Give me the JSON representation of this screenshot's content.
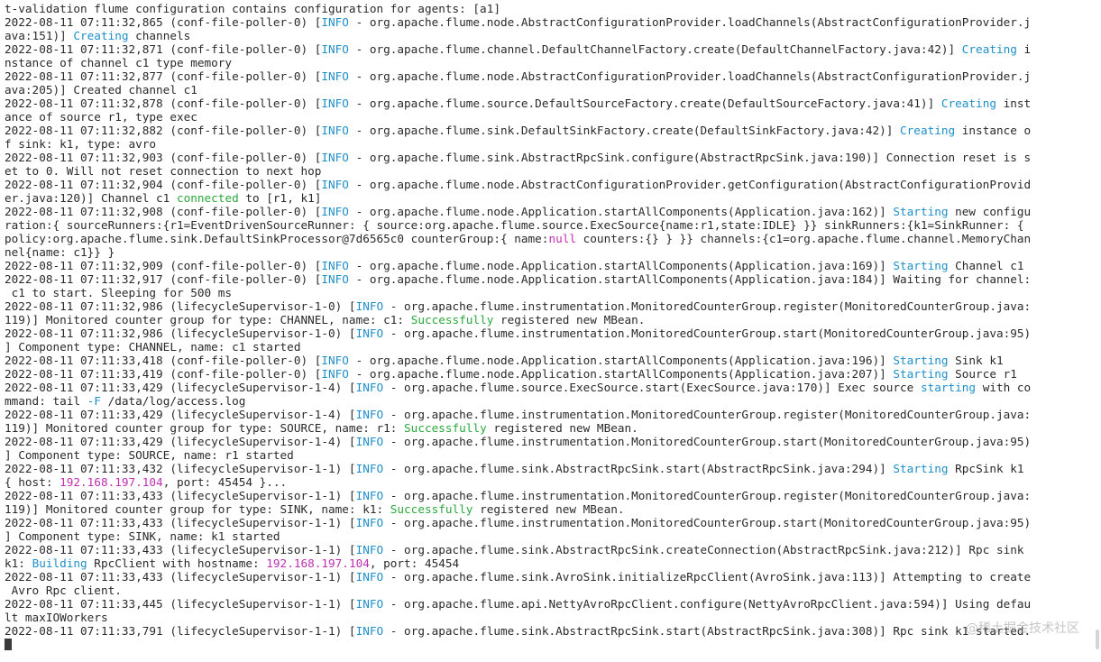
{
  "terminal": {
    "colors": {
      "background": "#ffffff",
      "text": "#2a2a2a",
      "info": "#1f8fc9",
      "keyword": "#1f8fc9",
      "success": "#2aa83d",
      "ip": "#c02fb3"
    },
    "lines": [
      [
        [
          "t-validation flume configuration contains configuration for agents: [a1]",
          ""
        ]
      ],
      [
        [
          "2022-08-11 07:11:32,865 (conf-file-poller-0) [",
          ""
        ],
        [
          "INFO",
          "info"
        ],
        [
          " - org.apache.flume.node.AbstractConfigurationProvider.loadChannels(AbstractConfigurationProvider.j",
          ""
        ]
      ],
      [
        [
          "ava:151)] ",
          ""
        ],
        [
          "Creating",
          "kw"
        ],
        [
          " channels",
          ""
        ]
      ],
      [
        [
          "2022-08-11 07:11:32,871 (conf-file-poller-0) [",
          ""
        ],
        [
          "INFO",
          "info"
        ],
        [
          " - org.apache.flume.channel.DefaultChannelFactory.create(DefaultChannelFactory.java:42)] ",
          ""
        ],
        [
          "Creating",
          "kw"
        ],
        [
          " i",
          ""
        ]
      ],
      [
        [
          "nstance of channel c1 type memory",
          ""
        ]
      ],
      [
        [
          "2022-08-11 07:11:32,877 (conf-file-poller-0) [",
          ""
        ],
        [
          "INFO",
          "info"
        ],
        [
          " - org.apache.flume.node.AbstractConfigurationProvider.loadChannels(AbstractConfigurationProvider.j",
          ""
        ]
      ],
      [
        [
          "ava:205)] Created channel c1",
          ""
        ]
      ],
      [
        [
          "2022-08-11 07:11:32,878 (conf-file-poller-0) [",
          ""
        ],
        [
          "INFO",
          "info"
        ],
        [
          " - org.apache.flume.source.DefaultSourceFactory.create(DefaultSourceFactory.java:41)] ",
          ""
        ],
        [
          "Creating",
          "kw"
        ],
        [
          " inst",
          ""
        ]
      ],
      [
        [
          "ance of source r1, type exec",
          ""
        ]
      ],
      [
        [
          "2022-08-11 07:11:32,882 (conf-file-poller-0) [",
          ""
        ],
        [
          "INFO",
          "info"
        ],
        [
          " - org.apache.flume.sink.DefaultSinkFactory.create(DefaultSinkFactory.java:42)] ",
          ""
        ],
        [
          "Creating",
          "kw"
        ],
        [
          " instance o",
          ""
        ]
      ],
      [
        [
          "f sink: k1, type: avro",
          ""
        ]
      ],
      [
        [
          "2022-08-11 07:11:32,903 (conf-file-poller-0) [",
          ""
        ],
        [
          "INFO",
          "info"
        ],
        [
          " - org.apache.flume.sink.AbstractRpcSink.configure(AbstractRpcSink.java:190)] Connection reset is s",
          ""
        ]
      ],
      [
        [
          "et to 0. Will not reset connection to next hop",
          ""
        ]
      ],
      [
        [
          "2022-08-11 07:11:32,904 (conf-file-poller-0) [",
          ""
        ],
        [
          "INFO",
          "info"
        ],
        [
          " - org.apache.flume.node.AbstractConfigurationProvider.getConfiguration(AbstractConfigurationProvid",
          ""
        ]
      ],
      [
        [
          "er.java:120)] Channel c1 ",
          ""
        ],
        [
          "connected",
          "green"
        ],
        [
          " to [r1, k1]",
          ""
        ]
      ],
      [
        [
          "2022-08-11 07:11:32,908 (conf-file-poller-0) [",
          ""
        ],
        [
          "INFO",
          "info"
        ],
        [
          " - org.apache.flume.node.Application.startAllComponents(Application.java:162)] ",
          ""
        ],
        [
          "Starting",
          "kw"
        ],
        [
          " new configu",
          ""
        ]
      ],
      [
        [
          "ration:{ sourceRunners:{r1=EventDrivenSourceRunner: { source:org.apache.flume.source.ExecSource{name:r1,state:IDLE} }} sinkRunners:{k1=SinkRunner: {",
          ""
        ]
      ],
      [
        [
          "policy:org.apache.flume.sink.DefaultSinkProcessor@7d6565c0 counterGroup:{ name:",
          ""
        ],
        [
          "null",
          "null"
        ],
        [
          " counters:{} } }} channels:{c1=org.apache.flume.channel.MemoryChan",
          ""
        ]
      ],
      [
        [
          "nel{name: c1}} }",
          ""
        ]
      ],
      [
        [
          "2022-08-11 07:11:32,909 (conf-file-poller-0) [",
          ""
        ],
        [
          "INFO",
          "info"
        ],
        [
          " - org.apache.flume.node.Application.startAllComponents(Application.java:169)] ",
          ""
        ],
        [
          "Starting",
          "kw"
        ],
        [
          " Channel c1",
          ""
        ]
      ],
      [
        [
          "2022-08-11 07:11:32,917 (conf-file-poller-0) [",
          ""
        ],
        [
          "INFO",
          "info"
        ],
        [
          " - org.apache.flume.node.Application.startAllComponents(Application.java:184)] Waiting for channel:",
          ""
        ]
      ],
      [
        [
          " c1 to start. Sleeping for 500 ms",
          ""
        ]
      ],
      [
        [
          "2022-08-11 07:11:32,986 (lifecycleSupervisor-1-0) [",
          ""
        ],
        [
          "INFO",
          "info"
        ],
        [
          " - org.apache.flume.instrumentation.MonitoredCounterGroup.register(MonitoredCounterGroup.java:",
          ""
        ]
      ],
      [
        [
          "119)] Monitored counter group for type: CHANNEL, name: c1: ",
          ""
        ],
        [
          "Successfully",
          "green"
        ],
        [
          " registered new MBean.",
          ""
        ]
      ],
      [
        [
          "2022-08-11 07:11:32,986 (lifecycleSupervisor-1-0) [",
          ""
        ],
        [
          "INFO",
          "info"
        ],
        [
          " - org.apache.flume.instrumentation.MonitoredCounterGroup.start(MonitoredCounterGroup.java:95)",
          ""
        ]
      ],
      [
        [
          "] Component type: CHANNEL, name: c1 started",
          ""
        ]
      ],
      [
        [
          "2022-08-11 07:11:33,418 (conf-file-poller-0) [",
          ""
        ],
        [
          "INFO",
          "info"
        ],
        [
          " - org.apache.flume.node.Application.startAllComponents(Application.java:196)] ",
          ""
        ],
        [
          "Starting",
          "kw"
        ],
        [
          " Sink k1",
          ""
        ]
      ],
      [
        [
          "2022-08-11 07:11:33,419 (conf-file-poller-0) [",
          ""
        ],
        [
          "INFO",
          "info"
        ],
        [
          " - org.apache.flume.node.Application.startAllComponents(Application.java:207)] ",
          ""
        ],
        [
          "Starting",
          "kw"
        ],
        [
          " Source r1",
          ""
        ]
      ],
      [
        [
          "2022-08-11 07:11:33,429 (lifecycleSupervisor-1-4) [",
          ""
        ],
        [
          "INFO",
          "info"
        ],
        [
          " - org.apache.flume.source.ExecSource.start(ExecSource.java:170)] Exec source ",
          ""
        ],
        [
          "starting",
          "kw"
        ],
        [
          " with co",
          ""
        ]
      ],
      [
        [
          "mmand: tail ",
          ""
        ],
        [
          "-F",
          "kw"
        ],
        [
          " /data/log/access.log",
          ""
        ]
      ],
      [
        [
          "2022-08-11 07:11:33,429 (lifecycleSupervisor-1-4) [",
          ""
        ],
        [
          "INFO",
          "info"
        ],
        [
          " - org.apache.flume.instrumentation.MonitoredCounterGroup.register(MonitoredCounterGroup.java:",
          ""
        ]
      ],
      [
        [
          "119)] Monitored counter group for type: SOURCE, name: r1: ",
          ""
        ],
        [
          "Successfully",
          "green"
        ],
        [
          " registered new MBean.",
          ""
        ]
      ],
      [
        [
          "2022-08-11 07:11:33,429 (lifecycleSupervisor-1-4) [",
          ""
        ],
        [
          "INFO",
          "info"
        ],
        [
          " - org.apache.flume.instrumentation.MonitoredCounterGroup.start(MonitoredCounterGroup.java:95)",
          ""
        ]
      ],
      [
        [
          "] Component type: SOURCE, name: r1 started",
          ""
        ]
      ],
      [
        [
          "2022-08-11 07:11:33,432 (lifecycleSupervisor-1-1) [",
          ""
        ],
        [
          "INFO",
          "info"
        ],
        [
          " - org.apache.flume.sink.AbstractRpcSink.start(AbstractRpcSink.java:294)] ",
          ""
        ],
        [
          "Starting",
          "kw"
        ],
        [
          " RpcSink k1",
          ""
        ]
      ],
      [
        [
          "{ host: ",
          ""
        ],
        [
          "192.168.197.104",
          "ip"
        ],
        [
          ", port: 45454 }...",
          ""
        ]
      ],
      [
        [
          "2022-08-11 07:11:33,433 (lifecycleSupervisor-1-1) [",
          ""
        ],
        [
          "INFO",
          "info"
        ],
        [
          " - org.apache.flume.instrumentation.MonitoredCounterGroup.register(MonitoredCounterGroup.java:",
          ""
        ]
      ],
      [
        [
          "119)] Monitored counter group for type: SINK, name: k1: ",
          ""
        ],
        [
          "Successfully",
          "green"
        ],
        [
          " registered new MBean.",
          ""
        ]
      ],
      [
        [
          "2022-08-11 07:11:33,433 (lifecycleSupervisor-1-1) [",
          ""
        ],
        [
          "INFO",
          "info"
        ],
        [
          " - org.apache.flume.instrumentation.MonitoredCounterGroup.start(MonitoredCounterGroup.java:95)",
          ""
        ]
      ],
      [
        [
          "] Component type: SINK, name: k1 started",
          ""
        ]
      ],
      [
        [
          "2022-08-11 07:11:33,433 (lifecycleSupervisor-1-1) [",
          ""
        ],
        [
          "INFO",
          "info"
        ],
        [
          " - org.apache.flume.sink.AbstractRpcSink.createConnection(AbstractRpcSink.java:212)] Rpc sink",
          ""
        ]
      ],
      [
        [
          "k1: ",
          ""
        ],
        [
          "Building",
          "kw"
        ],
        [
          " RpcClient with hostname: ",
          ""
        ],
        [
          "192.168.197.104",
          "ip"
        ],
        [
          ", port: 45454",
          ""
        ]
      ],
      [
        [
          "2022-08-11 07:11:33,433 (lifecycleSupervisor-1-1) [",
          ""
        ],
        [
          "INFO",
          "info"
        ],
        [
          " - org.apache.flume.sink.AvroSink.initializeRpcClient(AvroSink.java:113)] Attempting to create",
          ""
        ]
      ],
      [
        [
          " Avro Rpc client.",
          ""
        ]
      ],
      [
        [
          "2022-08-11 07:11:33,445 (lifecycleSupervisor-1-1) [",
          ""
        ],
        [
          "INFO",
          "info"
        ],
        [
          " - org.apache.flume.api.NettyAvroRpcClient.configure(NettyAvroRpcClient.java:594)] Using defau",
          ""
        ]
      ],
      [
        [
          "lt maxIOWorkers",
          ""
        ]
      ],
      [
        [
          "2022-08-11 07:11:33,791 (lifecycleSupervisor-1-1) [",
          ""
        ],
        [
          "INFO",
          "info"
        ],
        [
          " - org.apache.flume.sink.AbstractRpcSink.start(AbstractRpcSink.java:308)] Rpc sink k1 started.",
          ""
        ]
      ]
    ],
    "watermark": "@稀土掘金技术社区"
  }
}
